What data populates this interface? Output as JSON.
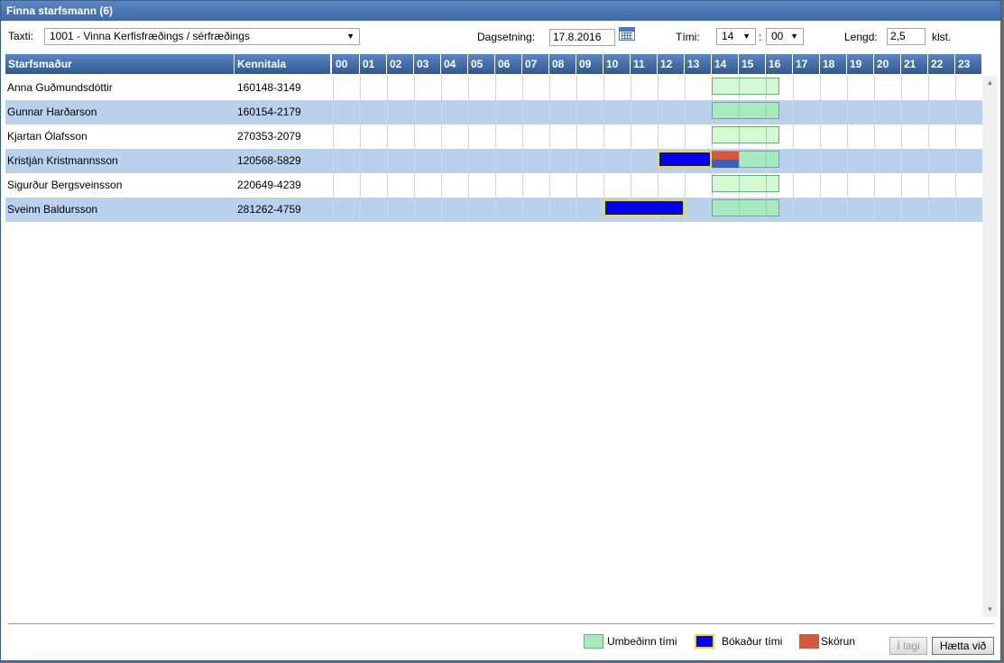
{
  "window": {
    "title": "Finna starfsmann (6)"
  },
  "filters": {
    "taxti_label": "Taxti:",
    "taxti_value": "1001 - Vinna Kerfisfræðings / sérfræðings",
    "date_label": "Dagsetning:",
    "date_value": "17.8.2016",
    "time_label": "Tími:",
    "hour_value": "14",
    "time_sep": ":",
    "minute_value": "00",
    "length_label": "Lengd:",
    "length_value": "2,5",
    "length_unit": "klst."
  },
  "grid": {
    "col_name": "Starfsmaður",
    "col_kennitala": "Kennitala",
    "hours": [
      "00",
      "01",
      "02",
      "03",
      "04",
      "05",
      "06",
      "07",
      "08",
      "09",
      "10",
      "11",
      "12",
      "13",
      "14",
      "15",
      "16",
      "17",
      "18",
      "19",
      "20",
      "21",
      "22",
      "23"
    ],
    "requested": {
      "start": 14,
      "end": 16.5
    },
    "rows": [
      {
        "name": "Anna Guðmundsdóttir",
        "kt": "160148-3149",
        "booked": []
      },
      {
        "name": "Gunnar Harðarson",
        "kt": "160154-2179",
        "booked": []
      },
      {
        "name": "Kjartan Ólafsson",
        "kt": "270353-2079",
        "booked": []
      },
      {
        "name": "Kristján Kristmannsson",
        "kt": "120568-5829",
        "booked": [
          {
            "start": 12,
            "end": 15
          }
        ]
      },
      {
        "name": "Sigurður Bergsveinsson",
        "kt": "220649-4239",
        "booked": []
      },
      {
        "name": "Sveinn Baldursson",
        "kt": "281262-4759",
        "booked": [
          {
            "start": 10,
            "end": 13
          }
        ]
      }
    ]
  },
  "legend": {
    "requested": "Umbeðinn tími",
    "booked": "Bókaður tími",
    "conflict": "Skörun"
  },
  "buttons": {
    "ok": "Í lagi",
    "cancel": "Hætta við"
  },
  "colors": {
    "requested": "#a9e9c0",
    "booked": "#0000ee",
    "booked_border": "#f2e000",
    "conflict": "#d4573b",
    "header": "#3d68a8",
    "row_alt": "#b9d1ec"
  }
}
